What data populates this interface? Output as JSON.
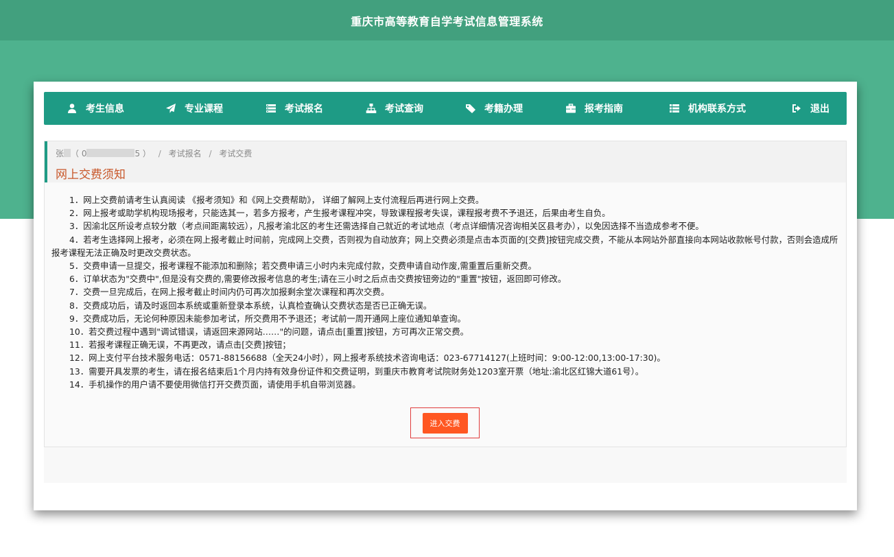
{
  "header": {
    "title": "重庆市高等教育自学考试信息管理系统"
  },
  "nav": {
    "items": [
      {
        "label": "考生信息",
        "icon": "user-icon"
      },
      {
        "label": "专业课程",
        "icon": "paper-plane-icon"
      },
      {
        "label": "考试报名",
        "icon": "list-card-icon"
      },
      {
        "label": "考试查询",
        "icon": "sitemap-icon"
      },
      {
        "label": "考籍办理",
        "icon": "tags-icon"
      },
      {
        "label": "报考指南",
        "icon": "briefcase-icon"
      },
      {
        "label": "机构联系方式",
        "icon": "list-icon"
      },
      {
        "label": "退出",
        "icon": "sign-out-icon"
      }
    ]
  },
  "breadcrumb": {
    "user_name": "张",
    "id_prefix": "（ 0",
    "id_suffix": "5 ）",
    "step1": "考试报名",
    "step2": "考试交费"
  },
  "panel": {
    "title": "网上交费须知"
  },
  "notice": {
    "items": [
      "1．网上交费前请考生认真阅读 《报考须知》和《网上交费帮助》， 详细了解网上支付流程后再进行网上交费。",
      "2．网上报考或助学机构现场报考，只能选其一，若多方报考，产生报考课程冲突，导致课程报考失误，课程报考费不予退还，后果由考生自负。",
      "3．因渝北区所设考点较分散（考点间距离较远），凡报考渝北区的考生还需选择自己就近的考试地点（考点详细情况咨询相关区县考办），以免因选择不当造成参考不便。",
      "4．若考生选择网上报考，必须在网上报考截止时间前，完成网上交费，否则视为自动放弃；网上交费必须是点击本页面的[交费]按钮完成交费，不能从本网站外部直接向本网站收款帐号付款，否则会造成所报考课程无法正确及时更改交费状态。",
      "5．交费申请一旦提交，报考课程不能添加和删除；若交费申请三小时内未完成付款，交费申请自动作废,需重置后重新交费。",
      "6．订单状态为\"交费中\",但是没有交费的,需要修改报考信息的考生;请在三小时之后点击交费按钮旁边的\"重置\"按钮，返回即可修改。",
      "7．交费一旦完成后，在网上报考截止时间内仍可再次加报剩余堂次课程和再次交费。",
      "8．交费成功后，请及时返回本系统或重新登录本系统，认真检查确认交费状态是否已正确无误。",
      "9．交费成功后，无论何种原因未能参加考试，所交费用不予退还；考试前一周开通网上座位通知单查询。",
      "10．若交费过程中遇到\"调试错误，请返回来源网站……\"的问题，请点击[重置]按钮，方可再次正常交费。",
      "11．若报考课程正确无误，不再更改，请点击[交费]按钮；",
      "12．网上支付平台技术服务电话：0571-88156688（全天24小时），网上报考系统技术咨询电话：023-67714127(上班时间：9:00-12:00,13:00-17:30)。",
      "13．需要开具发票的考生，请在报名结束后1个月内持有效身份证件和交费证明，到重庆市教育考试院财务处1203室开票（地址:渝北区红锦大道61号）。",
      "14．手机操作的用户请不要使用微信打开交费页面，请使用手机自带浏览器。"
    ]
  },
  "actions": {
    "pay_label": "进入交费"
  },
  "colors": {
    "header_bg": "#42a07e",
    "band_bg": "#4eb28e",
    "nav_bg": "#1e9b85",
    "title_color": "#c8572a",
    "button_bg": "#ff5722"
  }
}
